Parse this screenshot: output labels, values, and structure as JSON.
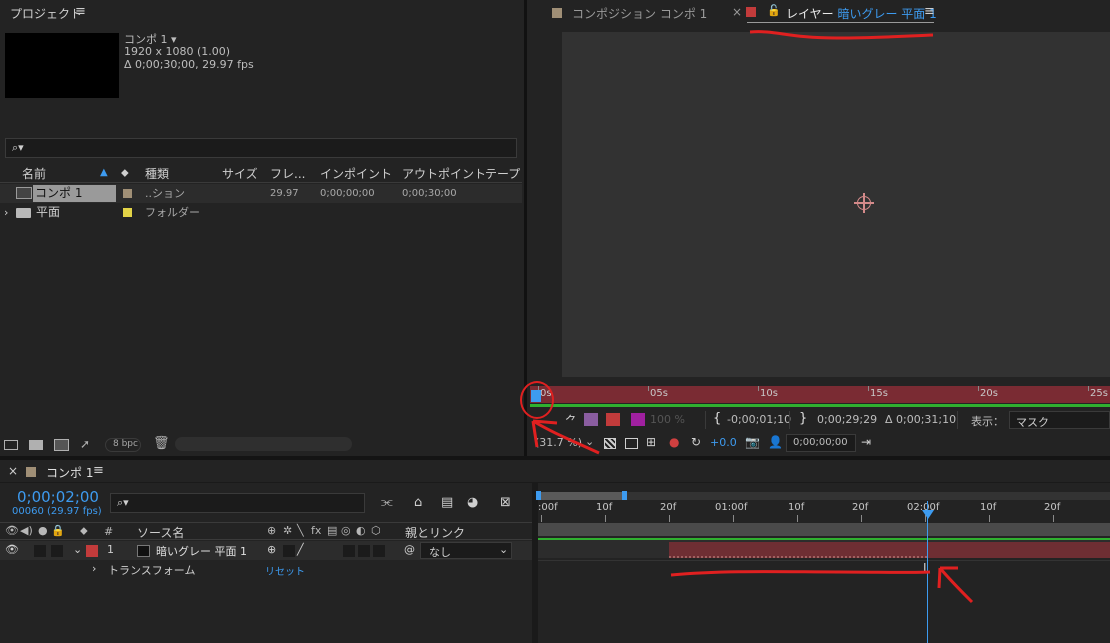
{
  "project": {
    "title": "プロジェクト",
    "menu": "≡",
    "selected_name": "コンポ 1",
    "selected_arrow": "▾",
    "resolution": "1920 x 1080 (1.00)",
    "duration": "Δ 0;00;30;00, 29.97 fps",
    "search_glyph": "⌕▾",
    "columns": [
      "名前",
      "種類",
      "サイズ",
      "フレ...",
      "インポイント",
      "アウトポイント",
      "テープ"
    ],
    "rows": [
      {
        "name": "コンポ 1",
        "swatch": "#a08f76",
        "type": "..ション",
        "size": "",
        "fps": "29.97",
        "in": "0;00;00;00",
        "out": "0;00;30;00"
      },
      {
        "name": "平面",
        "swatch": "#e2d347",
        "type": "フォルダー",
        "size": "",
        "fps": "",
        "in": "",
        "out": ""
      }
    ],
    "bpc": "8 bpc"
  },
  "viewer": {
    "tab_comp": "コンポジション コンポ 1",
    "tab_layer_prefix": "レイヤー",
    "tab_layer_name": "暗いグレー 平面 1",
    "tab_menu": "≡",
    "close": "×",
    "ruler_labels": [
      "0s",
      "05s",
      "10s",
      "15s",
      "20s",
      "25s"
    ],
    "opacity": "100 %",
    "in_time": "-0;00;01;10",
    "out_time": "0;00;29;29",
    "dur_time": "Δ 0;00;31;10",
    "view_label": "表示：",
    "view_value": "マスク",
    "zoom": "(31.7 %)",
    "exposure": "+0.0",
    "timecode": "0;00;00;00"
  },
  "timeline": {
    "close": "×",
    "comp_name": "コンポ 1",
    "menu": "≡",
    "current_time": "0;00;02;00",
    "frames": "00060 (29.97 fps)",
    "search_glyph": "⌕▾",
    "col_num": "#",
    "col_source": "ソース名",
    "col_parent": "親とリンク",
    "layer_index": "1",
    "layer_name": "暗いグレー 平面 1",
    "parent_value": "なし",
    "transform_label": "トランスフォーム",
    "reset_label": "リセット",
    "ruler_labels": [
      ":00f",
      "10f",
      "20f",
      "01:00f",
      "10f",
      "20f",
      "02:00f",
      "10f",
      "20f"
    ]
  },
  "colors": {
    "accent": "#3d9bf0",
    "layer_red": "#c23b3b",
    "bar_red": "#6e2e33",
    "green": "#2fb02f",
    "annotation_red": "#e02020"
  }
}
